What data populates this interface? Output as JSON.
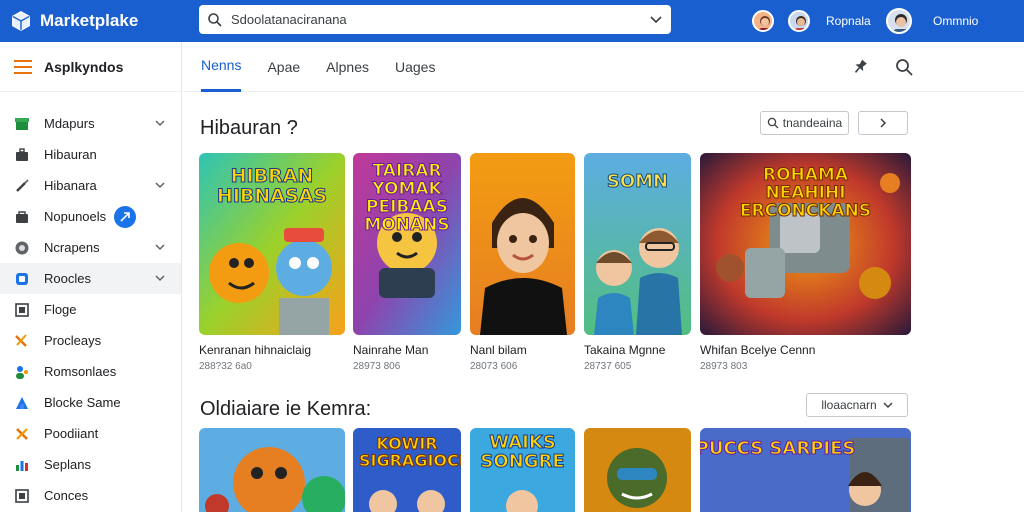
{
  "app": {
    "name": "Marketplake"
  },
  "search": {
    "value": "Sdoolatanaciranana",
    "placeholder": ""
  },
  "account": {
    "name1": "Ropnala",
    "name2": "Ommnio"
  },
  "sidebar": {
    "title": "Asplkyndos",
    "items": [
      {
        "label": "Mdapurs",
        "icon": "store-icon",
        "chevron": true
      },
      {
        "label": "Hibauran",
        "icon": "briefcase-icon",
        "chevron": false
      },
      {
        "label": "Hibanara",
        "icon": "brush-icon",
        "chevron": true
      },
      {
        "label": "Nopunoels",
        "icon": "bag-icon",
        "chevron": false,
        "badge": true
      },
      {
        "label": "Ncrapens",
        "icon": "globe-icon",
        "chevron": true
      },
      {
        "label": "Roocles",
        "icon": "app-icon",
        "chevron": true,
        "active": true
      },
      {
        "label": "Floge",
        "icon": "photo-icon",
        "chevron": false
      },
      {
        "label": "Procleays",
        "icon": "tools-icon",
        "chevron": false
      },
      {
        "label": "Romsonlaes",
        "icon": "people-icon",
        "chevron": false
      },
      {
        "label": "Blocke Same",
        "icon": "blocks-icon",
        "chevron": false
      },
      {
        "label": "Poodiiant",
        "icon": "cross-icon",
        "chevron": false
      },
      {
        "label": "Seplans",
        "icon": "chart-icon",
        "chevron": false
      },
      {
        "label": "Conces",
        "icon": "square-icon",
        "chevron": false
      }
    ]
  },
  "tabs": [
    {
      "label": "Nenns",
      "active": true
    },
    {
      "label": "Apae",
      "active": false
    },
    {
      "label": "Alpnes",
      "active": false
    },
    {
      "label": "Uages",
      "active": false
    }
  ],
  "section1": {
    "title": "Hibauran ?",
    "search_pill": "tnandeaina",
    "cards": [
      {
        "title": "Kenranan hihnaiclaig",
        "meta": "288?32 6a0",
        "art": "HIBRAN HIBNASAS"
      },
      {
        "title": "Nainrahe Man",
        "meta": "28973 806",
        "art": "TAIRAR YOMAK PEIBAAS MONANS"
      },
      {
        "title": "Nanl bilam",
        "meta": "28073 606",
        "art": ""
      },
      {
        "title": "Takaina Mgnne",
        "meta": "28737 605",
        "art": "SOMN"
      },
      {
        "title": "Whifan Bcelye Cennn",
        "meta": "28973 803",
        "art": "ROHAMA NEAHIHI ERCONCKANS"
      }
    ]
  },
  "section2": {
    "title": "Oldiaiare ie Kemra:",
    "dropdown": "lloaacnarn",
    "cards": [
      {
        "art": ""
      },
      {
        "art": "KOWIR SIGRAGIOCE"
      },
      {
        "art": "WAIKS SONGRE"
      },
      {
        "art": ""
      },
      {
        "art": "PUCCS SARPIES"
      }
    ]
  },
  "colors": {
    "brand": "#1a5fd0",
    "accent": "#1a73e8"
  }
}
